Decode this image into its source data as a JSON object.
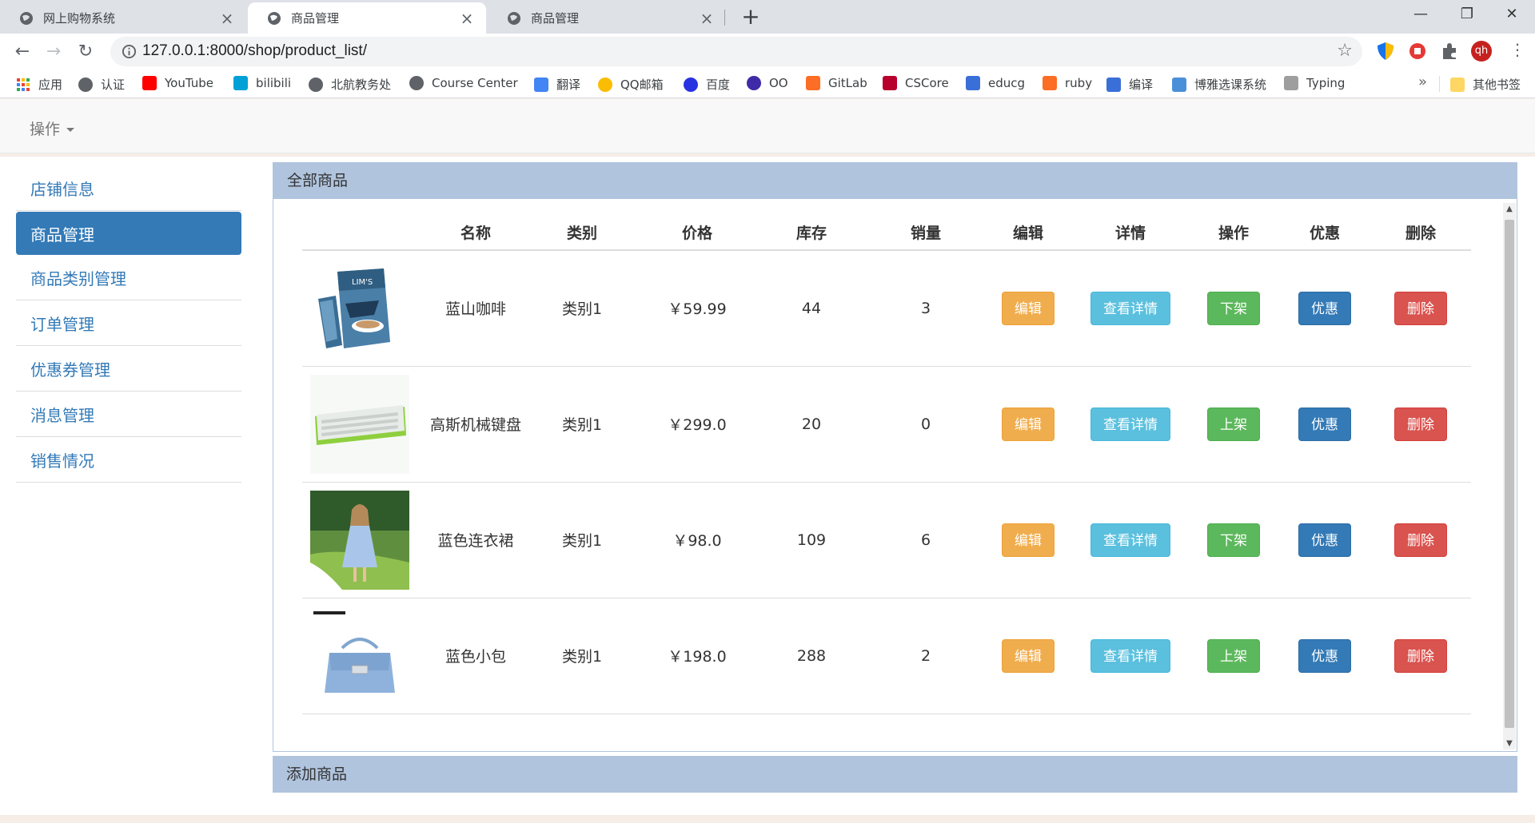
{
  "browser": {
    "tabs": [
      {
        "title": "网上购物系统",
        "active": false
      },
      {
        "title": "商品管理",
        "active": true
      },
      {
        "title": "商品管理",
        "active": false
      }
    ],
    "new_tab": "+",
    "window_controls": {
      "minimize": "—",
      "restore": "❐",
      "close": "✕"
    },
    "url": "127.0.0.1:8000/shop/product_list/",
    "profile_initials": "qh",
    "bookmarks": [
      {
        "label": "应用",
        "icon": "apps-grid-icon"
      },
      {
        "label": "认证",
        "icon": "globe-icon"
      },
      {
        "label": "YouTube",
        "icon": "youtube-icon"
      },
      {
        "label": "bilibili",
        "icon": "bilibili-icon"
      },
      {
        "label": "北航教务处",
        "icon": "globe-icon"
      },
      {
        "label": "Course Center",
        "icon": "globe-icon"
      },
      {
        "label": "翻译",
        "icon": "translate-icon"
      },
      {
        "label": "QQ邮箱",
        "icon": "qq-mail-icon"
      },
      {
        "label": "百度",
        "icon": "baidu-icon"
      },
      {
        "label": "OO",
        "icon": "hexagon-icon"
      },
      {
        "label": "GitLab",
        "icon": "gitlab-icon"
      },
      {
        "label": "CSCore",
        "icon": "edx-icon"
      },
      {
        "label": "educg",
        "icon": "educg-icon"
      },
      {
        "label": "ruby",
        "icon": "gitlab-icon"
      },
      {
        "label": "编译",
        "icon": "educg-icon"
      },
      {
        "label": "博雅选课系统",
        "icon": "book-icon"
      },
      {
        "label": "Typing",
        "icon": "typing-icon"
      }
    ],
    "bookmarks_more": "»",
    "other_bookmarks": "其他书签"
  },
  "topnav": {
    "operations_label": "操作"
  },
  "sidebar": {
    "items": [
      {
        "label": "店铺信息",
        "active": false
      },
      {
        "label": "商品管理",
        "active": true
      },
      {
        "label": "商品类别管理",
        "active": false
      },
      {
        "label": "订单管理",
        "active": false
      },
      {
        "label": "优惠券管理",
        "active": false
      },
      {
        "label": "消息管理",
        "active": false
      },
      {
        "label": "销售情况",
        "active": false
      }
    ]
  },
  "products_panel": {
    "title": "全部商品",
    "columns": [
      "",
      "名称",
      "类别",
      "价格",
      "库存",
      "销量",
      "编辑",
      "详情",
      "操作",
      "优惠",
      "删除"
    ],
    "rows": [
      {
        "image": "coffee-package-image",
        "name": "蓝山咖啡",
        "category": "类别1",
        "price": "￥59.99",
        "stock": "44",
        "sales": "3",
        "edit": "编辑",
        "detail": "查看详情",
        "action": "下架",
        "discount": "优惠",
        "delete": "删除"
      },
      {
        "image": "mechanical-keyboard-image",
        "name": "高斯机械键盘",
        "category": "类别1",
        "price": "￥299.0",
        "stock": "20",
        "sales": "0",
        "edit": "编辑",
        "detail": "查看详情",
        "action": "上架",
        "discount": "优惠",
        "delete": "删除"
      },
      {
        "image": "blue-dress-image",
        "name": "蓝色连衣裙",
        "category": "类别1",
        "price": "￥98.0",
        "stock": "109",
        "sales": "6",
        "edit": "编辑",
        "detail": "查看详情",
        "action": "下架",
        "discount": "优惠",
        "delete": "删除"
      },
      {
        "image": "blue-handbag-image",
        "name": "蓝色小包",
        "category": "类别1",
        "price": "￥198.0",
        "stock": "288",
        "sales": "2",
        "edit": "编辑",
        "detail": "查看详情",
        "action": "上架",
        "discount": "优惠",
        "delete": "删除"
      }
    ]
  },
  "add_panel": {
    "title": "添加商品"
  },
  "colors": {
    "panel_heading": "#b0c4de",
    "primary": "#337ab7",
    "warning": "#f0ad4e",
    "info": "#5bc0de",
    "success": "#5cb85c",
    "danger": "#d9534f"
  }
}
